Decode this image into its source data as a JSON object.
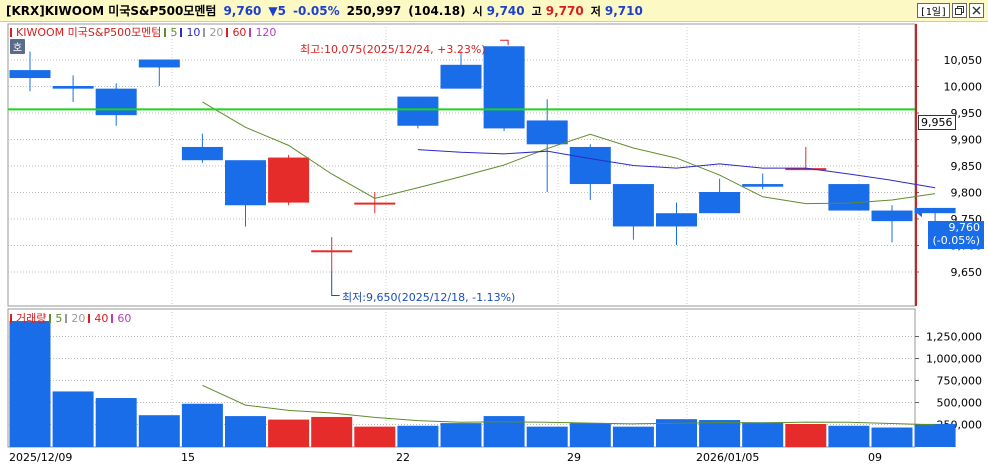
{
  "header": {
    "ticker": "[KRX]KIWOOM 미국S&P500모멘텀",
    "price": "9,760",
    "change": "▼5",
    "change_pct": "-0.05%",
    "volume": "250,997",
    "vol_ratio": "(104.18)",
    "open_label": "시",
    "open": "9,740",
    "high_label": "고",
    "high": "9,770",
    "low_label": "저",
    "low": "9,710",
    "period_button": "[1일]",
    "restore_icon": "restore-icon",
    "close_icon": "close-icon"
  },
  "colors": {
    "up": "#e62b2b",
    "down": "#1a6de8",
    "ma5": "#5f8d2a",
    "ma10": "#2b2bc6",
    "ma20": "#999999",
    "ma60": "#d81e1e",
    "ma120": "#b53ec0",
    "hline": "#18d818"
  },
  "price_panel": {
    "hoga_button": "호",
    "legend": {
      "name": "KIWOOM 미국S&P500모멘텀",
      "items": [
        "5",
        "10",
        "20",
        "60",
        "120"
      ]
    },
    "max_annotation": "최고:10,075(2025/12/24, +3.23%)",
    "min_annotation": "최저:9,650(2025/12/18, -1.13%)",
    "hline_label": "9,956",
    "current_price_label": "9,760",
    "current_change_label": "(-0.05%)"
  },
  "volume_panel": {
    "legend": {
      "name": "거래량",
      "items": [
        "5",
        "20",
        "40",
        "60"
      ]
    }
  },
  "x_labels": [
    "2025/12/09",
    "15",
    "22",
    "29",
    "2026/01/05",
    "09"
  ],
  "chart_data": [
    {
      "type": "candlestick",
      "title": "KIWOOM 미국S&P500모멘텀",
      "dates": [
        "2025/12/09",
        "2025/12/10",
        "2025/12/11",
        "2025/12/12",
        "2025/12/15",
        "2025/12/16",
        "2025/12/17",
        "2025/12/18",
        "2025/12/19",
        "2025/12/22",
        "2025/12/23",
        "2025/12/24",
        "2025/12/26",
        "2025/12/29",
        "2025/12/30",
        "2025/12/31",
        "2026/01/02",
        "2026/01/05",
        "2026/01/06",
        "2026/01/07",
        "2026/01/08",
        "2026/01/09"
      ],
      "open": [
        10030,
        10000,
        9995,
        10050,
        9885,
        9860,
        9780,
        9690,
        9780,
        9980,
        10040,
        10075,
        9935,
        9885,
        9815,
        9760,
        9800,
        9815,
        9845,
        9815,
        9765,
        9770
      ],
      "close": [
        10015,
        9995,
        9945,
        10035,
        9860,
        9775,
        9865,
        9690,
        9780,
        9925,
        9995,
        9920,
        9890,
        9815,
        9735,
        9735,
        9760,
        9810,
        9845,
        9765,
        9745,
        9760
      ],
      "high": [
        10065,
        10020,
        10005,
        10050,
        9910,
        9860,
        9870,
        9715,
        9800,
        9980,
        10065,
        10075,
        9975,
        9890,
        9815,
        9780,
        9825,
        9835,
        9885,
        9815,
        9775,
        9770
      ],
      "low": [
        9990,
        9970,
        9925,
        10000,
        9855,
        9735,
        9775,
        9650,
        9760,
        9920,
        9995,
        9915,
        9800,
        9785,
        9710,
        9700,
        9760,
        9805,
        9845,
        9765,
        9705,
        9710
      ],
      "ma5": [
        null,
        null,
        null,
        null,
        9970,
        9922,
        9888,
        9834,
        9788,
        9808,
        9829,
        9851,
        9882,
        9909,
        9883,
        9864,
        9832,
        9791,
        9778,
        9779,
        9785,
        9797
      ],
      "ma10": [
        null,
        null,
        null,
        null,
        null,
        null,
        null,
        null,
        null,
        9880,
        9875,
        9872,
        9877,
        9863,
        9850,
        9845,
        9853,
        9845,
        9845,
        9834,
        9822,
        9808
      ],
      "hline": 9956,
      "ylim": [
        9600,
        10100
      ],
      "yticks": [
        9650,
        9700,
        9750,
        9800,
        9850,
        9900,
        9950,
        10000,
        10050
      ],
      "ytick_labels": [
        "9,650",
        "9,700",
        "9,750",
        "9,800",
        "9,850",
        "9,900",
        "9,950",
        "10,000",
        "10,050"
      ]
    },
    {
      "type": "bar",
      "title": "거래량",
      "values": [
        1420000,
        620000,
        545000,
        350000,
        480000,
        340000,
        300000,
        330000,
        220000,
        230000,
        260000,
        340000,
        220000,
        260000,
        220000,
        305000,
        295000,
        270000,
        250000,
        230000,
        210000,
        250997
      ],
      "ma5": [
        null,
        null,
        null,
        null,
        690000,
        465000,
        405000,
        375000,
        325000,
        288000,
        270000,
        275000,
        270000,
        260000,
        252000,
        258000,
        265000,
        262000,
        272000,
        270000,
        255000,
        240000
      ],
      "ylim": [
        0,
        1500000
      ],
      "yticks": [
        250000,
        500000,
        750000,
        1000000,
        1250000
      ],
      "ytick_labels": [
        "250,000",
        "500,000",
        "750,000",
        "1,000,000",
        "1,250,000"
      ]
    }
  ]
}
